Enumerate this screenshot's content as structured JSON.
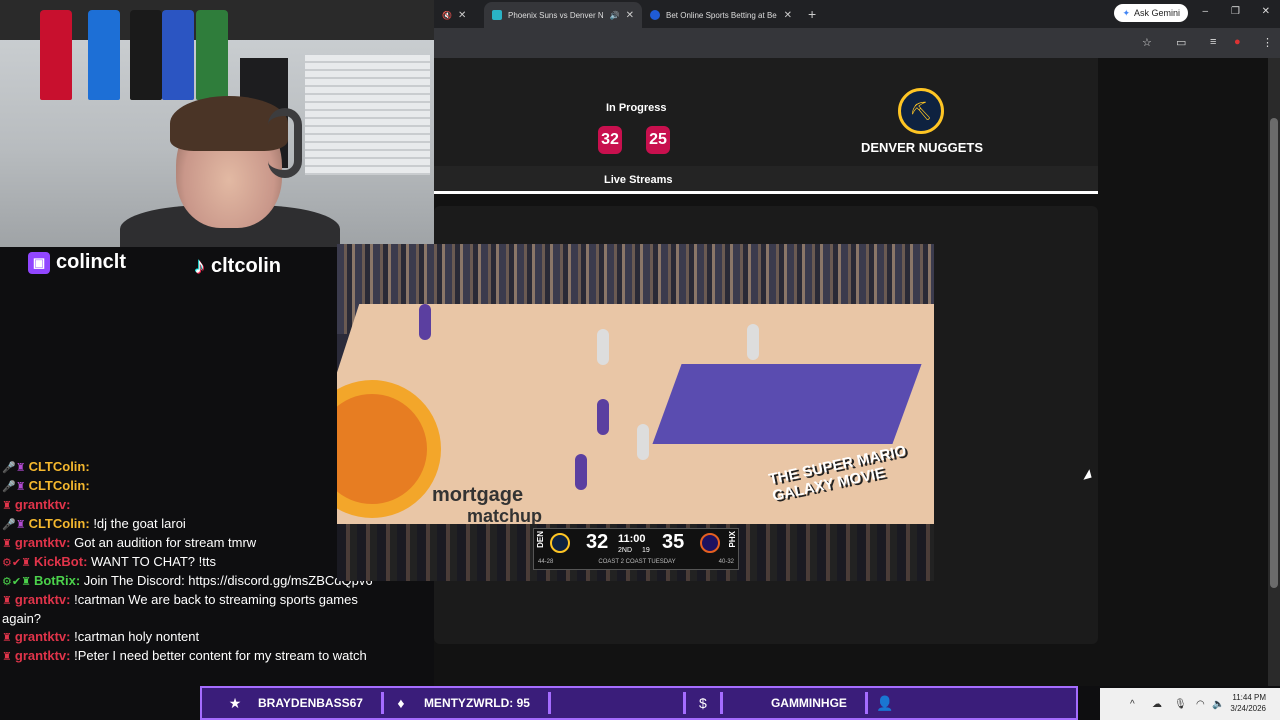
{
  "browser": {
    "tabs": [
      {
        "title": "Phoenix Suns vs Denver Nu",
        "active": true
      },
      {
        "title": "Bet Online Sports Betting at Be",
        "active": false
      }
    ],
    "new_tab_symbol": "+",
    "gemini_label": "Ask Gemini",
    "tab_close_symbol": "✕",
    "window_controls": {
      "minimize": "–",
      "maximize": "❐",
      "close": "✕"
    }
  },
  "game": {
    "status": "In Progress",
    "score_left": "32",
    "score_right": "25",
    "team_name": "DENVER NUGGETS",
    "streams_tab_label": "Live Streams"
  },
  "video": {
    "arena_text_1": "mortgage",
    "arena_text_2": "matchup",
    "movie_text": "THE SUPER MARIO GALAXY MOVIE",
    "scorebug": {
      "team_left": "DEN",
      "score_left": "32",
      "clock": "11:00",
      "quarter": "2ND",
      "shot_clock": "19",
      "score_right": "35",
      "team_right": "PHX",
      "record_left": "44-28",
      "record_right": "40-32",
      "footer": "COAST 2 COAST TUESDAY"
    }
  },
  "overlay": {
    "twitch_handle": "colinclt",
    "tiktok_handle": "cltcolin",
    "twitch_icon": "twitch-logo",
    "tiktok_icon": "tiktok-logo"
  },
  "chat": [
    {
      "user": "CLTColin:",
      "message": "",
      "cls": "u-colin",
      "badges": "🎤♜"
    },
    {
      "user": "CLTColin:",
      "message": "",
      "cls": "u-colin",
      "badges": "🎤♜"
    },
    {
      "user": "grantktv:",
      "message": "",
      "cls": "u-grant",
      "badges": "♜"
    },
    {
      "user": "CLTColin:",
      "message": " !dj the goat laroi",
      "cls": "u-colin",
      "badges": "🎤♜"
    },
    {
      "user": "grantktv:",
      "message": " Got an audition for stream tmrw",
      "cls": "u-grant",
      "badges": "♜"
    },
    {
      "user": "KickBot:",
      "message": " WANT TO CHAT? !tts",
      "cls": "u-kick",
      "badges": "⚙✔♜"
    },
    {
      "user": "BotRix:",
      "message": " Join The Discord: https://discord.gg/msZBCdQpv6",
      "cls": "u-botrix",
      "badges": "⚙✔♜"
    },
    {
      "user": "grantktv:",
      "message": " !cartman We are back to streaming sports games again?",
      "cls": "u-grant",
      "badges": "♜"
    },
    {
      "user": "grantktv:",
      "message": " !cartman holy nontent",
      "cls": "u-grant",
      "badges": "♜"
    },
    {
      "user": "grantktv:",
      "message": " !Peter I need better content for my stream to watch",
      "cls": "u-grant",
      "badges": "♜"
    }
  ],
  "ticker": {
    "item1": "BRAYDENBASS67",
    "item2": "MENTYZWRLD: 95",
    "item3": "",
    "item4": "GAMMINHGE",
    "star_icon": "★",
    "diamond_icon": "♦",
    "dollar_icon": "$",
    "user_icon": "👤"
  },
  "taskbar": {
    "time": "11:44 PM",
    "date": "3/24/2026"
  }
}
